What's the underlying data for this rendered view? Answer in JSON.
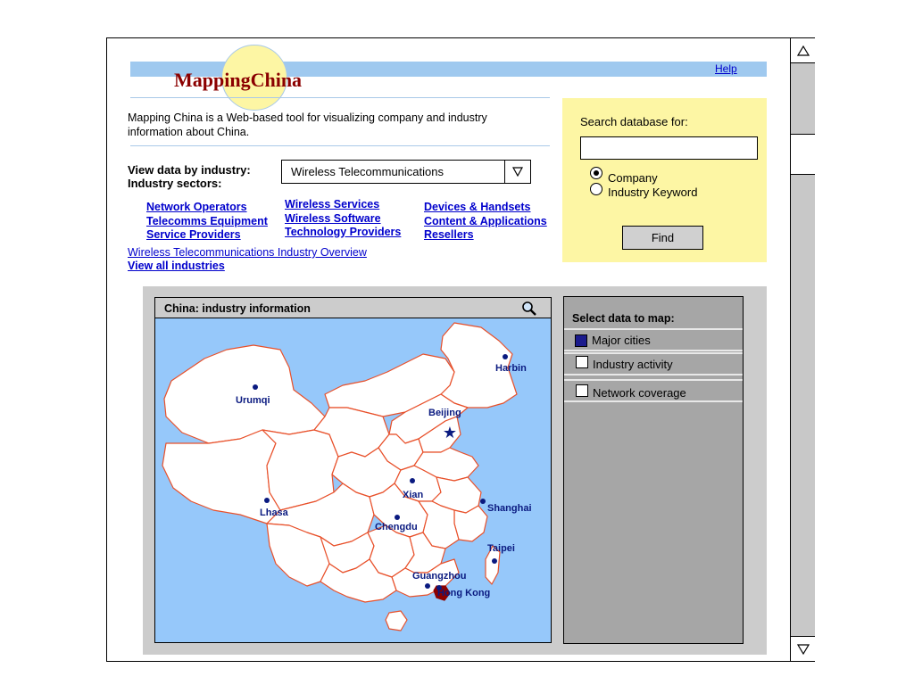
{
  "app": {
    "logo_text": "MappingChina",
    "help_label": "Help",
    "description": "Mapping China is a Web-based tool for visualizing company and industry information about China."
  },
  "search": {
    "label": "Search database for:",
    "input_value": "",
    "options": [
      {
        "label": "Company",
        "selected": true
      },
      {
        "label": "Industry Keyword",
        "selected": false
      }
    ],
    "find_label": "Find"
  },
  "industry": {
    "view_label": "View data by industry:",
    "sectors_label": "Industry sectors:",
    "selected": "Wireless Telecommunications",
    "sectors_col1": [
      "Network Operators",
      "Telecomms Equipment",
      "Service Providers"
    ],
    "sectors_col2": [
      "Wireless Services",
      "Wireless Software",
      "Technology Providers"
    ],
    "sectors_col3": [
      "Devices & Handsets",
      "Content & Applications",
      "Resellers"
    ],
    "overview_link": "Wireless Telecommunications Industry Overview",
    "view_all_link": "View all industries"
  },
  "map": {
    "title": "China: industry information",
    "cities": [
      {
        "name": "Harbin",
        "capital": false
      },
      {
        "name": "Urumqi",
        "capital": false
      },
      {
        "name": "Beijing",
        "capital": true
      },
      {
        "name": "Xian",
        "capital": false
      },
      {
        "name": "Shanghai",
        "capital": false
      },
      {
        "name": "Lhasa",
        "capital": false
      },
      {
        "name": "Chengdu",
        "capital": false
      },
      {
        "name": "Taipei",
        "capital": false
      },
      {
        "name": "Guangzhou",
        "capital": false
      },
      {
        "name": "Hong Kong",
        "capital": false
      }
    ],
    "colors": {
      "sea": "#96c8fa",
      "land": "#ffffff",
      "border": "#e8502a",
      "city": "#0a1a80",
      "hongkong": "#8b0000"
    }
  },
  "data_panel": {
    "title": "Select data to map:",
    "items": [
      {
        "label": "Major cities",
        "checked": true
      },
      {
        "label": "Industry activity",
        "checked": false
      },
      {
        "label": "Network coverage",
        "checked": false
      }
    ]
  },
  "scrollbar": {
    "up_icon": "triangle-up-icon",
    "down_icon": "triangle-down-icon"
  }
}
